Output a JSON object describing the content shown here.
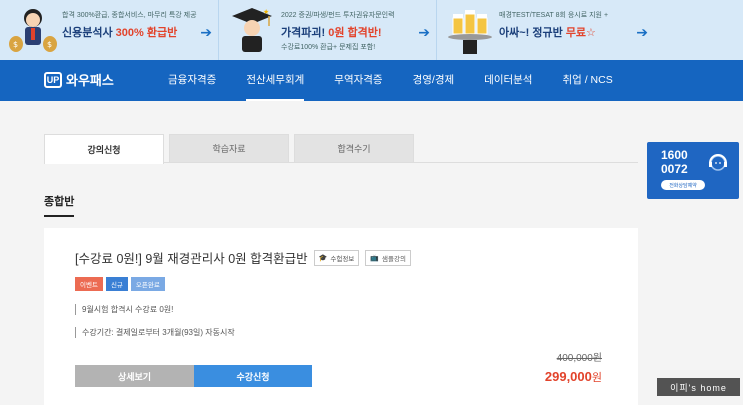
{
  "promo": [
    {
      "small": "합격 300%환급, 종합서비스, 마무리 특강 제공",
      "big_pre": "신용분석사 ",
      "big_em": "300% 환급반",
      "sub": "",
      "art": "man-with-money-bags"
    },
    {
      "small": "2022 증권/파생/펀드 투자권유자문인력",
      "big_pre": "가격파괴! ",
      "big_em": "0원 합격반!",
      "sub": "수강료100% 환급+ 문제집 포함!",
      "art": "graduate-with-cap"
    },
    {
      "small": "매경TEST/TESAT 8회 응시료 지원 +",
      "big_pre": "아싸~! 정규반 ",
      "big_em": "무료☆",
      "sub": "",
      "art": "waiter-with-drinks"
    }
  ],
  "nav": {
    "logo": "와우패스",
    "logo_mark": "UP",
    "items": [
      "금융자격증",
      "전산세무회계",
      "무역자격증",
      "경영/경제",
      "데이터분석",
      "취업 / NCS"
    ],
    "active_index": 1
  },
  "tabs": [
    "강의신청",
    "학습자료",
    "합격수기"
  ],
  "section_title": "종합반",
  "course": {
    "title": "[수강료 0원!] 9월 재경관리사 0원 합격환급반",
    "chip_exam": "수험정보",
    "chip_sample": "샘플강의",
    "badges": [
      "이벤트",
      "신규",
      "오픈완료"
    ],
    "desc": [
      "9월시험 합격시 수강료 0원!",
      "수강기간: 결제일로부터 3개월(93일) 자동시작"
    ],
    "detail_button": "상세보기",
    "apply_button": "수강신청",
    "price_old": "400,000원",
    "price_new": "299,000",
    "price_unit": "원"
  },
  "consult": {
    "number_line1": "1600",
    "number_line2": "0072",
    "label": "전화상담예약"
  },
  "watermark": "이피's home",
  "colors": {
    "nav_bg": "#1565c0",
    "accent_red": "#e2432b",
    "apply_blue": "#3a8ee0",
    "promo_bg": "#d7e9f8"
  }
}
